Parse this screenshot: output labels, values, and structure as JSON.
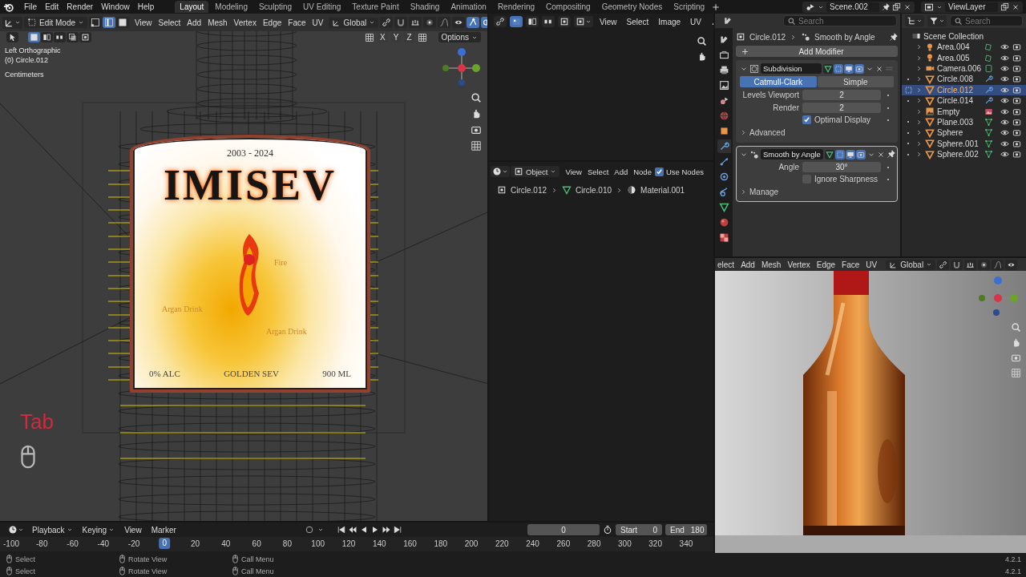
{
  "topbar": {
    "menus": [
      "File",
      "Edit",
      "Render",
      "Window",
      "Help"
    ],
    "workspaces": [
      {
        "label": "Layout",
        "selected": true
      },
      {
        "label": "Modeling",
        "selected": false
      },
      {
        "label": "Sculpting",
        "selected": false
      },
      {
        "label": "UV Editing",
        "selected": false
      },
      {
        "label": "Texture Paint",
        "selected": false
      },
      {
        "label": "Shading",
        "selected": false
      },
      {
        "label": "Animation",
        "selected": false
      },
      {
        "label": "Rendering",
        "selected": false
      },
      {
        "label": "Compositing",
        "selected": false
      },
      {
        "label": "Geometry Nodes",
        "selected": false
      },
      {
        "label": "Scripting",
        "selected": false
      }
    ],
    "scene": "Scene.002",
    "view_layer": "ViewLayer"
  },
  "viewport": {
    "mode": "Edit Mode",
    "select_modes": [
      {
        "selected": false
      },
      {
        "selected": true
      },
      {
        "selected": false
      }
    ],
    "menus": [
      "View",
      "Select",
      "Add",
      "Mesh",
      "Vertex",
      "Edge",
      "Face",
      "UV"
    ],
    "orientation": "Global",
    "axes": [
      "X",
      "Y",
      "Z"
    ],
    "options": "Options",
    "overlay_info": [
      "Left Orthographic",
      "(0) Circle.012",
      "Centimeters"
    ],
    "label": {
      "years": "2003 - 2024",
      "brand": "IMISEV",
      "notes": [
        "Fire",
        "Argan Drink",
        "Argan Drink"
      ],
      "footer": [
        "0% ALC",
        "GOLDEN SEV",
        "900 ML"
      ]
    },
    "key_overlay": "Tab"
  },
  "image_editor": {
    "menus": [
      "View",
      "Select",
      "Image",
      "UV"
    ]
  },
  "node_editor": {
    "object_type": "Object",
    "menus": [
      "View",
      "Select",
      "Add",
      "Node"
    ],
    "use_nodes": {
      "label": "Use Nodes",
      "checked": true
    },
    "breadcrumbs": [
      "Circle.012",
      "Circle.010",
      "Material.001"
    ]
  },
  "properties": {
    "search_placeholder": "Search",
    "breadcrumbs": [
      "Circle.012",
      "Smooth by Angle"
    ],
    "tabs": [
      {
        "kind": "tool",
        "selected": false
      },
      {
        "kind": "render",
        "selected": false
      },
      {
        "kind": "output",
        "selected": false
      },
      {
        "kind": "view_layer",
        "selected": false
      },
      {
        "kind": "scene",
        "selected": false
      },
      {
        "kind": "world",
        "selected": false
      },
      {
        "kind": "object",
        "selected": false
      },
      {
        "kind": "modifier",
        "selected": true
      },
      {
        "kind": "particles",
        "selected": false
      },
      {
        "kind": "physics",
        "selected": false
      },
      {
        "kind": "constraints",
        "selected": false
      },
      {
        "kind": "data",
        "selected": false
      },
      {
        "kind": "material",
        "selected": false
      },
      {
        "kind": "texture",
        "selected": false
      }
    ],
    "add_modifier": "Add Modifier",
    "modifiers": [
      {
        "name": "Subdivision",
        "kind": "subdivision",
        "active": false,
        "pinned": false,
        "algorithms": [
          {
            "label": "Catmull-Clark",
            "selected": true
          },
          {
            "label": "Simple",
            "selected": false
          }
        ],
        "fields": [
          {
            "label": "Levels Viewport",
            "value": "2"
          },
          {
            "label": "Render",
            "value": "2"
          }
        ],
        "options": [
          {
            "label": "Optimal Display",
            "checked": true
          }
        ],
        "subpanels": [
          "Advanced"
        ]
      },
      {
        "name": "Smooth by Angle",
        "kind": "smooth",
        "active": true,
        "pinned": true,
        "fields": [
          {
            "label": "Angle",
            "value": "30°"
          }
        ],
        "options": [
          {
            "label": "Ignore Sharpness",
            "checked": false
          }
        ],
        "subpanels": [
          "Manage"
        ]
      }
    ]
  },
  "outliner": {
    "search_placeholder": "Search",
    "root": "Scene Collection",
    "items": [
      {
        "name": "Area.004",
        "kind": "light",
        "has_modifiers": false,
        "edit_toggle": false,
        "selected": false
      },
      {
        "name": "Area.005",
        "kind": "light",
        "has_modifiers": false,
        "edit_toggle": false,
        "selected": false
      },
      {
        "name": "Camera.006",
        "kind": "camera",
        "has_modifiers": false,
        "edit_toggle": false,
        "selected": false
      },
      {
        "name": "Circle.008",
        "kind": "mesh",
        "has_modifiers": true,
        "edit_toggle": true,
        "selected": false
      },
      {
        "name": "Circle.012",
        "kind": "mesh",
        "has_modifiers": true,
        "edit_toggle": true,
        "selected": true
      },
      {
        "name": "Circle.014",
        "kind": "mesh",
        "has_modifiers": true,
        "edit_toggle": true,
        "selected": false
      },
      {
        "name": "Empty",
        "kind": "empty",
        "has_modifiers": false,
        "edit_toggle": false,
        "selected": false
      },
      {
        "name": "Plane.003",
        "kind": "mesh",
        "has_modifiers": false,
        "edit_toggle": true,
        "selected": false
      },
      {
        "name": "Sphere",
        "kind": "mesh",
        "has_modifiers": false,
        "edit_toggle": true,
        "selected": false
      },
      {
        "name": "Sphere.001",
        "kind": "mesh",
        "has_modifiers": false,
        "edit_toggle": true,
        "selected": false
      },
      {
        "name": "Sphere.002",
        "kind": "mesh",
        "has_modifiers": false,
        "edit_toggle": true,
        "selected": false
      }
    ]
  },
  "render_view": {
    "menus": [
      "elect",
      "Add",
      "Mesh",
      "Vertex",
      "Edge",
      "Face",
      "UV"
    ],
    "orientation": "Global"
  },
  "timeline": {
    "menus": [
      "Playback",
      "Keying",
      "View",
      "Marker"
    ],
    "current_frame": "0",
    "start": {
      "label": "Start",
      "value": "0"
    },
    "end": {
      "label": "End",
      "value": "180"
    },
    "ticks": [
      {
        "label": "-100",
        "current": false
      },
      {
        "label": "-80",
        "current": false
      },
      {
        "label": "-60",
        "current": false
      },
      {
        "label": "-40",
        "current": false
      },
      {
        "label": "-20",
        "current": false
      },
      {
        "label": "0",
        "current": true
      },
      {
        "label": "20",
        "current": false
      },
      {
        "label": "40",
        "current": false
      },
      {
        "label": "60",
        "current": false
      },
      {
        "label": "80",
        "current": false
      },
      {
        "label": "100",
        "current": false
      },
      {
        "label": "120",
        "current": false
      },
      {
        "label": "140",
        "current": false
      },
      {
        "label": "160",
        "current": false
      },
      {
        "label": "180",
        "current": false
      },
      {
        "label": "200",
        "current": false
      },
      {
        "label": "220",
        "current": false
      },
      {
        "label": "240",
        "current": false
      },
      {
        "label": "260",
        "current": false
      },
      {
        "label": "280",
        "current": false
      },
      {
        "label": "300",
        "current": false
      },
      {
        "label": "320",
        "current": false
      },
      {
        "label": "340",
        "current": false
      }
    ]
  },
  "status_bar": {
    "lines": [
      {
        "hints": [
          "Select",
          "Rotate View",
          "Call Menu"
        ],
        "version": "4.2.1"
      },
      {
        "hints": [
          "Select",
          "Rotate View",
          "Call Menu"
        ],
        "version": "4.2.1"
      }
    ]
  }
}
